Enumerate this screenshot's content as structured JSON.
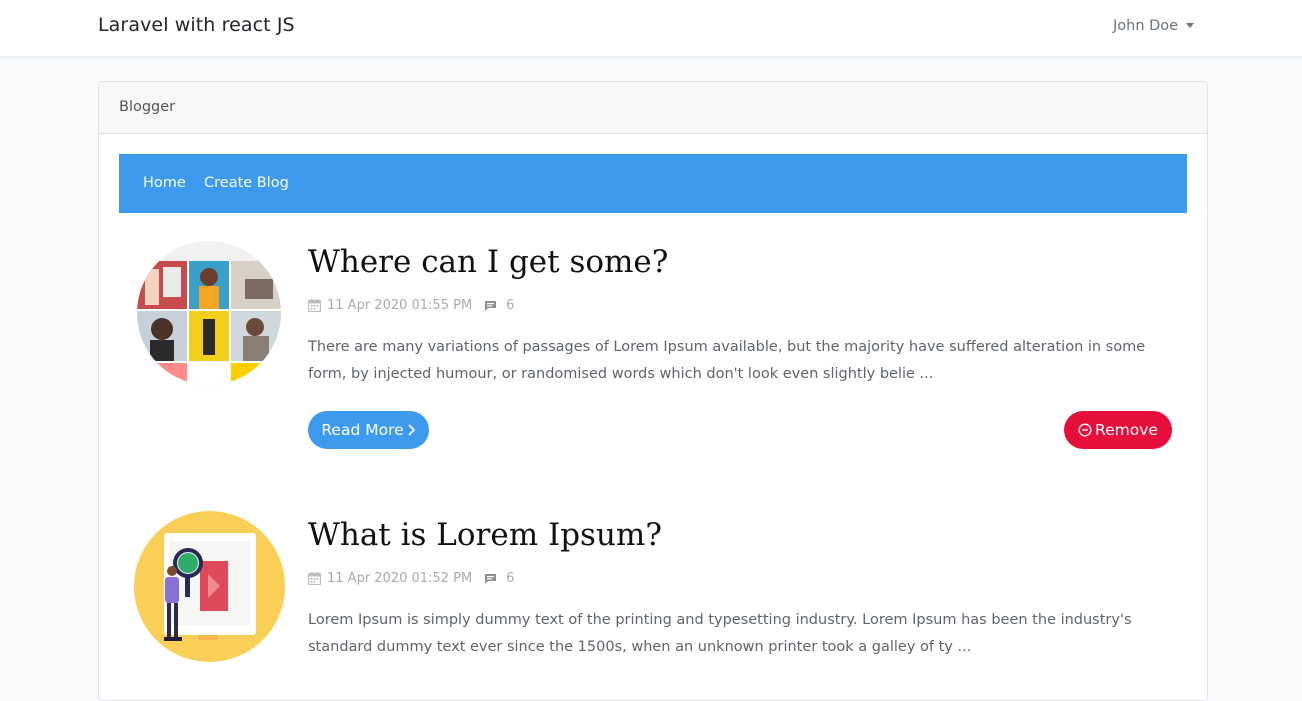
{
  "navbar": {
    "brand": "Laravel with react JS",
    "user_name": "John Doe"
  },
  "card": {
    "header_title": "Blogger"
  },
  "subnav": {
    "links": [
      {
        "label": "Home"
      },
      {
        "label": "Create Blog"
      }
    ]
  },
  "posts": [
    {
      "title": "Where can I get some?",
      "date": "11 Apr 2020 01:55 PM",
      "comments": "6",
      "excerpt_line1": "There are many variations of passages of Lorem Ipsum available, but the majority have suffered alteration in some",
      "excerpt_line2": "form, by injected humour, or randomised words which don't look even slightly belie ...",
      "read_more_label": "Read More",
      "remove_label": "Remove"
    },
    {
      "title": "What is Lorem Ipsum?",
      "date": "11 Apr 2020 01:52 PM",
      "comments": "6",
      "excerpt_line1": "Lorem Ipsum is simply dummy text of the printing and typesetting industry. Lorem Ipsum has been the industry's",
      "excerpt_line2": "standard dummy text ever since the 1500s, when an unknown printer took a galley of ty ..."
    }
  ],
  "icons": {
    "calendar": "calendar-icon",
    "comment": "comment-icon",
    "chevron": "chevron-right-icon",
    "remove": "minus-circle-icon"
  },
  "colors": {
    "primary": "#3c9bef",
    "danger": "#e60f3c",
    "muted": "#a7acb1"
  }
}
